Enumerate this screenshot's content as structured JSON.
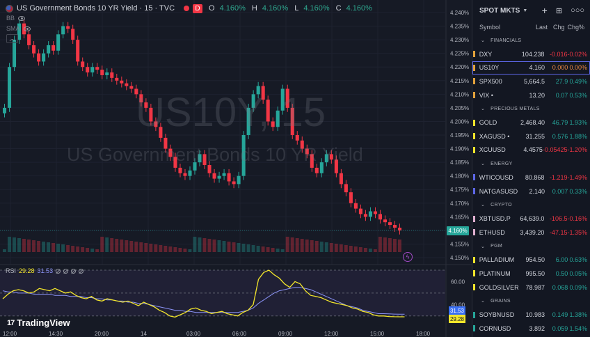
{
  "header": {
    "title": "US Government Bonds 10 YR Yield · 15 · TVC",
    "market_status": "D",
    "ohlc": {
      "o_label": "O",
      "o": "4.160%",
      "h_label": "H",
      "h": "4.160%",
      "l_label": "L",
      "l": "4.160%",
      "c_label": "C",
      "c": "4.160%"
    }
  },
  "indicators": {
    "bb": "BB",
    "sma": "SMA"
  },
  "watermark": {
    "symbol": "US10Y, 15",
    "name": "US Government Bonds 10 YR Yield"
  },
  "price_axis": [
    "4.240%",
    "4.235%",
    "4.230%",
    "4.225%",
    "4.220%",
    "4.215%",
    "4.210%",
    "4.205%",
    "4.200%",
    "4.195%",
    "4.190%",
    "4.185%",
    "4.180%",
    "4.175%",
    "4.170%",
    "4.165%",
    "4.160%",
    "4.155%",
    "4.150%"
  ],
  "current_price": "4.160%",
  "rsi": {
    "label": "RSI",
    "value1": "29.28",
    "value2": "31.53",
    "axis": [
      "60.00",
      "40.00"
    ],
    "tag_ma": "31.53",
    "tag_rsi": "29.28"
  },
  "time_axis": [
    "12:00",
    "14:30",
    "20:00",
    "14",
    "03:00",
    "06:00",
    "09:00",
    "12:00",
    "15:00",
    "18:00"
  ],
  "brand": "TradingView",
  "chart_data": {
    "type": "candlestick",
    "symbol": "US10Y",
    "interval": "15",
    "ylim": [
      4.15,
      4.24
    ],
    "close_series": [
      4.205,
      4.22,
      4.23,
      4.236,
      4.232,
      4.228,
      4.225,
      4.222,
      4.225,
      4.228,
      4.226,
      4.232,
      4.235,
      4.234,
      4.23,
      4.222,
      4.22,
      4.218,
      4.22,
      4.219,
      4.217,
      4.218,
      4.216,
      4.215,
      4.214,
      4.213,
      4.212,
      4.21,
      4.207,
      4.205,
      4.2,
      4.198,
      4.194,
      4.19,
      4.187,
      4.183,
      4.181,
      4.18,
      4.182,
      4.185,
      4.188,
      4.184,
      4.181,
      4.179,
      4.18,
      4.181,
      4.178,
      4.177,
      4.18,
      4.195,
      4.205,
      4.21,
      4.213,
      4.208,
      4.2,
      4.198,
      4.204,
      4.212,
      4.205,
      4.195,
      4.193,
      4.19,
      4.188,
      4.183,
      4.181,
      4.185,
      4.188,
      4.186,
      4.181,
      4.177,
      4.174,
      4.17,
      4.168,
      4.166,
      4.165,
      4.167,
      4.166,
      4.164,
      4.163,
      4.162,
      4.161,
      4.16
    ],
    "rsi_series": [
      45,
      49,
      52,
      53,
      52,
      50,
      51,
      54,
      53,
      52,
      54,
      52,
      50,
      51,
      48,
      46,
      45,
      47,
      44,
      43,
      45,
      44,
      43,
      42,
      43,
      41,
      39,
      42,
      40,
      38,
      35,
      33,
      30,
      29,
      31,
      33,
      36,
      37,
      35,
      34,
      32,
      33,
      34,
      32,
      31,
      30,
      33,
      35,
      40,
      62,
      68,
      70,
      66,
      63,
      58,
      55,
      60,
      58,
      52,
      48,
      47,
      46,
      44,
      42,
      41,
      40,
      39,
      37,
      36,
      34,
      33,
      31,
      30,
      30,
      29.5,
      29.3,
      29.28,
      29.28
    ],
    "rsi_ma_series": [
      52,
      51,
      51,
      50,
      50,
      50,
      49,
      49,
      49,
      49,
      48,
      48,
      48,
      47,
      47,
      47,
      46,
      46,
      45,
      45,
      44,
      44,
      43,
      43,
      42,
      42,
      41,
      41,
      40,
      39,
      38,
      37,
      36,
      35,
      35,
      34,
      34,
      33,
      33,
      33,
      33,
      33,
      33,
      33,
      33,
      33,
      34,
      35,
      37,
      41,
      44,
      47,
      50,
      52,
      53,
      54,
      55,
      55,
      54,
      53,
      51,
      49,
      47,
      45,
      43,
      41,
      39,
      38,
      37,
      35,
      34,
      33,
      32,
      32,
      31.8,
      31.6,
      31.53,
      31.53
    ]
  },
  "panel": {
    "title": "SPOT MKTS",
    "columns": {
      "symbol": "Symbol",
      "last": "Last",
      "chg": "Chg",
      "pct": "Chg%"
    },
    "sections": [
      {
        "name": "FINANCIALS",
        "rows": [
          {
            "sym": "DXY",
            "last": "104.238",
            "chg": "-0.016",
            "pct": "-0.02%",
            "dir": "neg",
            "color": "#e2a23b"
          },
          {
            "sym": "US10Y",
            "last": "4.160",
            "chg": "0.000",
            "pct": "0.00%",
            "dir": "zero",
            "color": "#e2a23b"
          },
          {
            "sym": "SPX500",
            "last": "5,664.5",
            "chg": "27.9",
            "pct": "0.49%",
            "dir": "pos",
            "color": "#e2a23b"
          },
          {
            "sym": "VIX •",
            "last": "13.20",
            "chg": "0.07",
            "pct": "0.53%",
            "dir": "pos",
            "color": "#e2a23b"
          }
        ]
      },
      {
        "name": "PRECIOUS METALS",
        "rows": [
          {
            "sym": "GOLD",
            "last": "2,468.40",
            "chg": "46.79",
            "pct": "1.93%",
            "dir": "pos",
            "color": "#f2e52b"
          },
          {
            "sym": "XAGUSD •",
            "last": "31.255",
            "chg": "0.576",
            "pct": "1.88%",
            "dir": "pos",
            "color": "#f2e52b"
          },
          {
            "sym": "XCUUSD",
            "last": "4.4575",
            "chg": "-0.05425",
            "pct": "-1.20%",
            "dir": "neg",
            "color": "#f2e52b"
          }
        ]
      },
      {
        "name": "ENERGY",
        "rows": [
          {
            "sym": "WTICOUSD",
            "last": "80.868",
            "chg": "-1.219",
            "pct": "-1.49%",
            "dir": "neg",
            "color": "#5d67e8"
          },
          {
            "sym": "NATGASUSD",
            "last": "2.140",
            "chg": "0.007",
            "pct": "0.33%",
            "dir": "pos",
            "color": "#5d67e8"
          }
        ]
      },
      {
        "name": "CRYPTO",
        "rows": [
          {
            "sym": "XBTUSD.P",
            "last": "64,639.0",
            "chg": "-106.5",
            "pct": "-0.16%",
            "dir": "neg",
            "color": "#e0b0d0"
          },
          {
            "sym": "ETHUSD",
            "last": "3,439.20",
            "chg": "-47.15",
            "pct": "-1.35%",
            "dir": "neg",
            "color": "#e0b0d0"
          }
        ]
      },
      {
        "name": "PGM",
        "rows": [
          {
            "sym": "PALLADIUM",
            "last": "954.50",
            "chg": "6.00",
            "pct": "0.63%",
            "dir": "pos",
            "color": "#f2e52b"
          },
          {
            "sym": "PLATINUM",
            "last": "995.50",
            "chg": "0.50",
            "pct": "0.05%",
            "dir": "pos",
            "color": "#f2e52b"
          },
          {
            "sym": "GOLDSILVER",
            "last": "78.987",
            "chg": "0.068",
            "pct": "0.09%",
            "dir": "pos",
            "color": "#f2e52b"
          }
        ]
      },
      {
        "name": "GRAINS",
        "rows": [
          {
            "sym": "SOYBNUSD",
            "last": "10.983",
            "chg": "0.149",
            "pct": "1.38%",
            "dir": "pos",
            "color": "#26a69a"
          },
          {
            "sym": "CORNUSD",
            "last": "3.892",
            "chg": "0.059",
            "pct": "1.54%",
            "dir": "pos",
            "color": "#26a69a"
          }
        ]
      }
    ]
  }
}
